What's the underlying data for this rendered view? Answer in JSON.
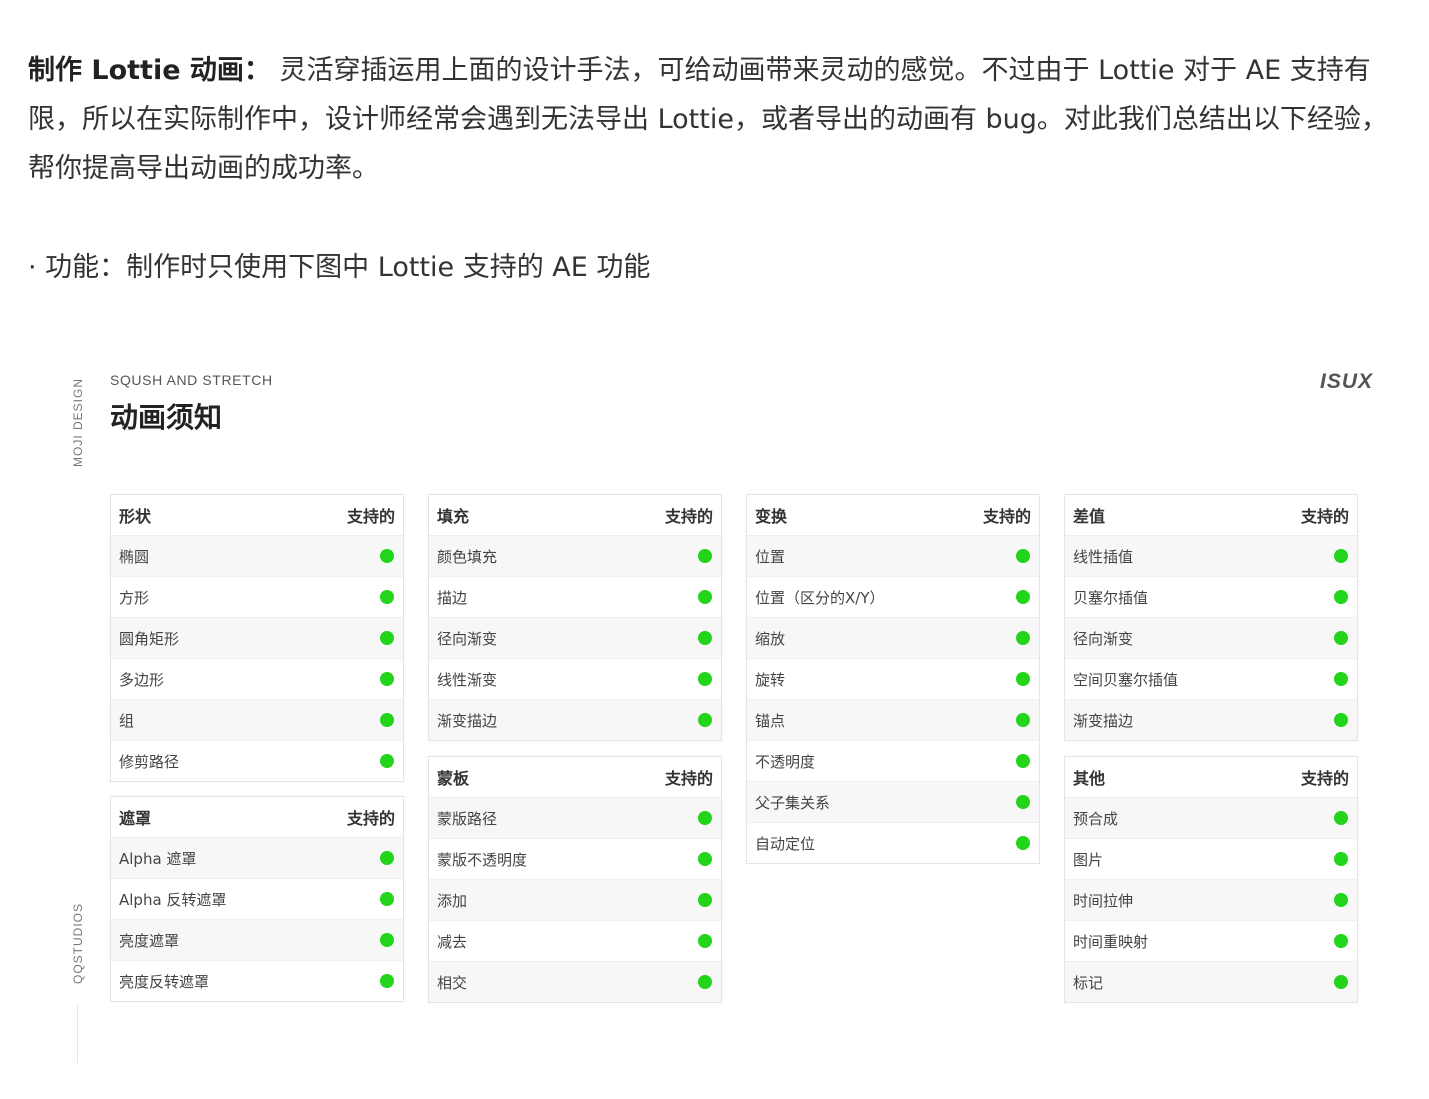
{
  "intro": {
    "bold_label": "制作 Lottie 动画：",
    "text": " 灵活穿插运用上面的设计手法，可给动画带来灵动的感觉。不过由于 Lottie 对于 AE 支持有限，所以在实际制作中，设计师经常会遇到无法导出 Lottie，或者导出的动画有 bug。对此我们总结出以下经验，帮你提高导出动画的成功率。"
  },
  "bullet": "· 功能：制作时只使用下图中 Lottie 支持的 AE 功能",
  "figure": {
    "side_top": "MOJI DESIGN",
    "side_bottom": "QQSTUDIOS",
    "subtitle": "SQUSH AND STRETCH",
    "title": "动画须知",
    "brand": "ISUX",
    "supported_color": "#22d41a",
    "panels": [
      {
        "title": "形状",
        "col": "支持的",
        "rows": [
          "椭圆",
          "方形",
          "圆角矩形",
          "多边形",
          "组",
          "修剪路径"
        ]
      },
      {
        "title": "遮罩",
        "col": "支持的",
        "rows": [
          "Alpha 遮罩",
          "Alpha 反转遮罩",
          "亮度遮罩",
          "亮度反转遮罩"
        ]
      },
      {
        "title": "填充",
        "col": "支持的",
        "rows": [
          "颜色填充",
          "描边",
          "径向渐变",
          "线性渐变",
          "渐变描边"
        ]
      },
      {
        "title": "蒙板",
        "col": "支持的",
        "rows": [
          "蒙版路径",
          "蒙版不透明度",
          "添加",
          "减去",
          "相交"
        ]
      },
      {
        "title": "变换",
        "col": "支持的",
        "rows": [
          "位置",
          "位置（区分的X/Y）",
          "缩放",
          "旋转",
          "锚点",
          "不透明度",
          "父子集关系",
          "自动定位"
        ]
      },
      {
        "title": "差值",
        "col": "支持的",
        "rows": [
          "线性插值",
          "贝塞尔插值",
          "径向渐变",
          "空间贝塞尔插值",
          "渐变描边"
        ]
      },
      {
        "title": "其他",
        "col": "支持的",
        "rows": [
          "预合成",
          "图片",
          "时间拉伸",
          "时间重映射",
          "标记"
        ]
      }
    ]
  }
}
